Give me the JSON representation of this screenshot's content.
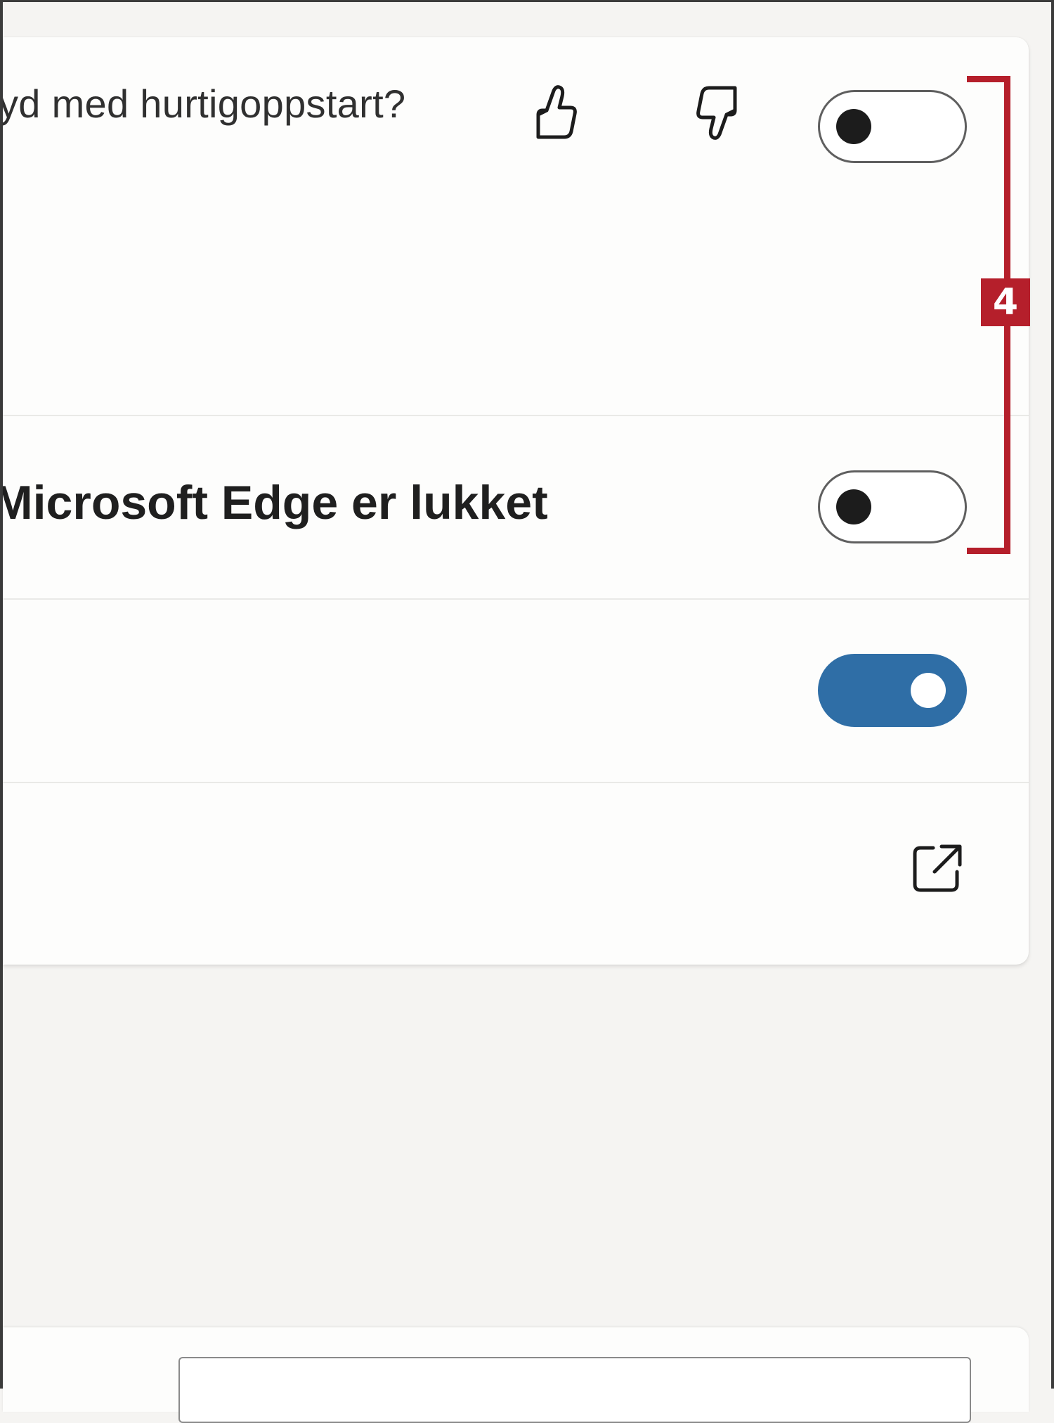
{
  "settings": {
    "feedback_question": "yd med hurtigoppstart?",
    "row_run_after_close": "Microsoft Edge er lukket",
    "toggles": {
      "startup_boost": "off",
      "run_after_close": "off",
      "row_three": "on"
    }
  },
  "annotation": {
    "badge_number": "4"
  },
  "colors": {
    "accent": "#2f6ea6",
    "annotation": "#b51f2b"
  }
}
